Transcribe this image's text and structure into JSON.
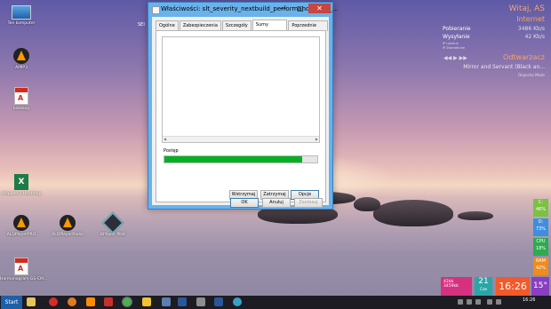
{
  "desktop_icons": [
    {
      "label": "Ten komputer",
      "icon": "computer-icon"
    },
    {
      "label": "AIMP3",
      "icon": "aimp-icon"
    },
    {
      "label": "bdoblog",
      "icon": "pdf-file-icon"
    },
    {
      "label": "stripped.2.Heatmap",
      "icon": "excel-file-icon"
    },
    {
      "label": "ALDPlayerPRO",
      "icon": "vlc-icon"
    },
    {
      "label": "ALDPlayerRadio",
      "icon": "vlc-icon"
    },
    {
      "label": "BPlayer Pilot",
      "icon": "diamond-app-icon"
    },
    {
      "label": "Harmonogram GS-CM...",
      "icon": "pdf-file-icon"
    }
  ],
  "desktop_extra_label": "SEI",
  "dialog": {
    "title": "Właściwości: slt_severity_nextbuild_performance_with_...",
    "min_glyph": "—",
    "max_glyph": "□",
    "close_glyph": "✕",
    "tabs": [
      "Ogólne",
      "Zabezpieczenia",
      "Szczegóły",
      "Sumy kontrolne",
      "Poprzednie wersje"
    ],
    "active_tab": "Sumy kontrolne",
    "progress_label": "Postęp",
    "progress_value": 0.9,
    "panel_buttons": {
      "pause": "Wstrzymaj",
      "stop": "Zatrzymaj",
      "options": "Opcje"
    },
    "dialog_buttons": {
      "ok": "OK",
      "cancel": "Anuluj",
      "apply": "Zastosuj"
    },
    "progress_color": "#06b025"
  },
  "widget": {
    "greeting": "Witaj, AS",
    "internet_title": "Internet",
    "download_label": "Pobieranie",
    "download_value": "3486 Kb/s",
    "upload_label": "Wysyłanie",
    "upload_value": "42 Kb/s",
    "ip_local": "IP Lokalne",
    "ip_external": "IP Zewnętrzne",
    "player_title": "Odtwarzacz",
    "player_controls": "◀◀ ▶ ▶▶",
    "song": "Mirror and Servant (Black an...",
    "artist": "Depeche Mode",
    "accent_color": "#f3a46f"
  },
  "gauges": [
    {
      "label": "C:",
      "value": "46%",
      "color": "#7cc142"
    },
    {
      "label": "D:",
      "value": "73%",
      "color": "#3e8ee0"
    },
    {
      "label": "CPU",
      "value": "18%",
      "color": "#2eaa4f"
    },
    {
      "label": "RAM",
      "value": "42%",
      "color": "#f08b1d"
    }
  ],
  "tiles": {
    "net_down": "42kb",
    "net_up": "3459kb",
    "date_day": "21",
    "date_month": "Czw",
    "time": "16:26",
    "temperature": "15°"
  },
  "taskbar": {
    "start_label": "Start",
    "clock": "16:26"
  }
}
